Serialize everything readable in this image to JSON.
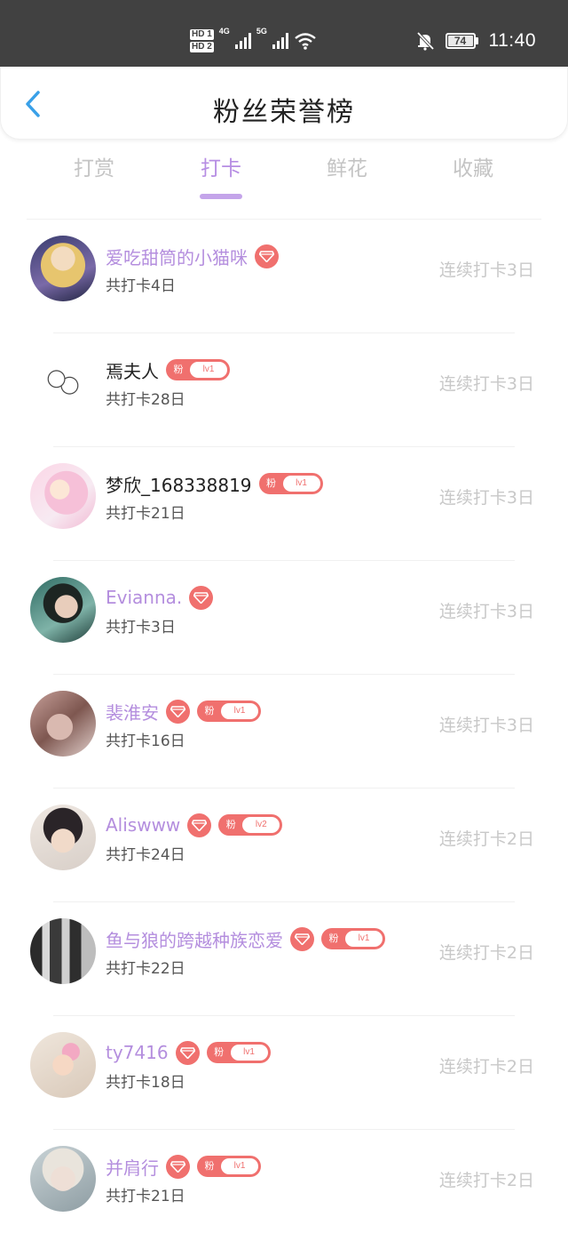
{
  "status_bar": {
    "sim1": "HD 1",
    "sim2": "HD 2",
    "network1": "4G",
    "network2": "5G",
    "battery_level": "74",
    "time": "11:40",
    "icons": [
      "signal-icon",
      "wifi-icon",
      "mute-bell-icon",
      "battery-icon"
    ]
  },
  "header": {
    "title": "粉丝荣誉榜",
    "back_icon": "chevron-left-icon",
    "accent_color": "#39a0e8"
  },
  "tabs": [
    {
      "label": "打赏",
      "active": false
    },
    {
      "label": "打卡",
      "active": true
    },
    {
      "label": "鲜花",
      "active": false
    },
    {
      "label": "收藏",
      "active": false
    }
  ],
  "colors": {
    "accent_purple": "#b48ede",
    "badge_red": "#f0706e",
    "muted_text": "#c8c8c8"
  },
  "fans": [
    {
      "name": "爱吃甜筒的小猫咪",
      "name_color": "purple",
      "gem": true,
      "fan_badge": false,
      "level": "",
      "total": "共打卡4日",
      "streak": "连续打卡3日",
      "avatar": "anime-girl-avatar"
    },
    {
      "name": "焉夫人",
      "name_color": "dark",
      "gem": false,
      "fan_badge": true,
      "level": "lv1",
      "total": "共打卡28日",
      "streak": "连续打卡3日",
      "avatar": "sketch-avatar"
    },
    {
      "name": "梦欣_168338819",
      "name_color": "dark",
      "gem": false,
      "fan_badge": true,
      "level": "lv1",
      "total": "共打卡21日",
      "streak": "连续打卡3日",
      "avatar": "pink-anime-avatar"
    },
    {
      "name": "Evianna.",
      "name_color": "purple",
      "gem": true,
      "fan_badge": false,
      "level": "",
      "total": "共打卡3日",
      "streak": "连续打卡3日",
      "avatar": "photo-avatar"
    },
    {
      "name": "裴淮安",
      "name_color": "purple",
      "gem": true,
      "fan_badge": true,
      "level": "lv1",
      "total": "共打卡16日",
      "streak": "连续打卡3日",
      "avatar": "blurred-photo-avatar"
    },
    {
      "name": "Aliswww",
      "name_color": "purple",
      "gem": true,
      "fan_badge": true,
      "level": "lv2",
      "total": "共打卡24日",
      "streak": "连续打卡2日",
      "avatar": "boy-photo-avatar"
    },
    {
      "name": "鱼与狼的跨越种族恋爱",
      "name_color": "purple",
      "gem": true,
      "fan_badge": true,
      "level": "lv1",
      "total": "共打卡22日",
      "streak": "连续打卡2日",
      "avatar": "group-photo-avatar"
    },
    {
      "name": "ty7416",
      "name_color": "purple",
      "gem": true,
      "fan_badge": true,
      "level": "lv1",
      "total": "共打卡18日",
      "streak": "连续打卡2日",
      "avatar": "child-photo-avatar"
    },
    {
      "name": "并肩行",
      "name_color": "purple",
      "gem": true,
      "fan_badge": true,
      "level": "lv1",
      "total": "共打卡21日",
      "streak": "连续打卡2日",
      "avatar": "portrait-avatar"
    }
  ],
  "fan_badge_label": "粉"
}
